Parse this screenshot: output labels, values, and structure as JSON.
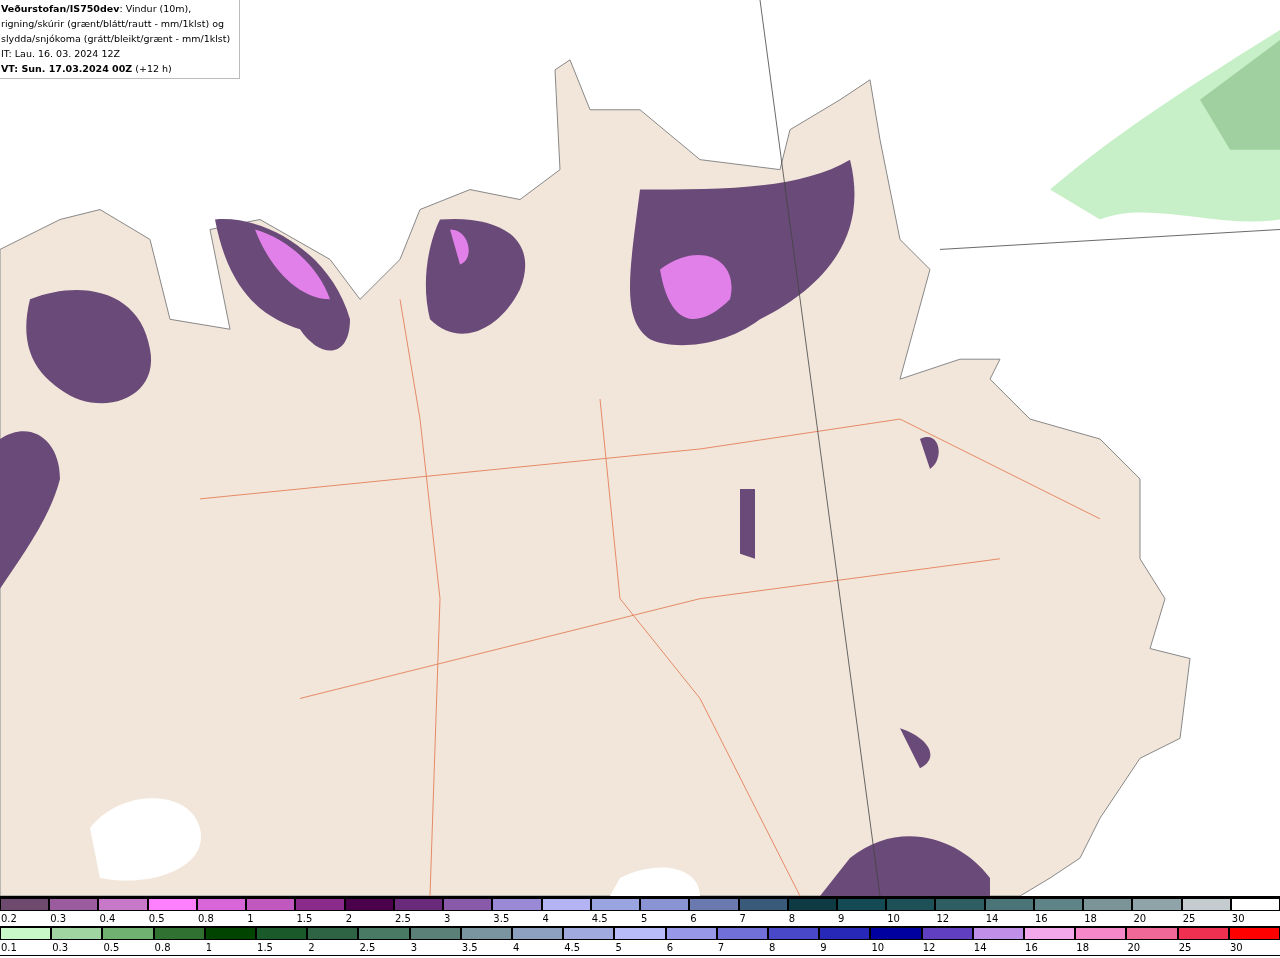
{
  "title_box": {
    "description": "**Veðurstofan/IS750dev**: Vindur (10m), rigning/skúrir (grænt/blátt/rautt - mm/1klst) og slydda/snjókoma (grátt/bleikt/grænt - mm/1klst)",
    "issue_time": "IT: Lau. 16. 03. 2024 12Z",
    "valid_time": "**VT: Sun. 17.03.2024 00Z** (+12 h)"
  },
  "legends": [
    {
      "steps": [
        {
          "label": "0.2",
          "color": "#6e4a6e"
        },
        {
          "label": "0.3",
          "color": "#9a5c9e"
        },
        {
          "label": "0.4",
          "color": "#c878c8"
        },
        {
          "label": "0.5",
          "color": "#ff80ff"
        },
        {
          "label": "0.8",
          "color": "#d966d9"
        },
        {
          "label": "1",
          "color": "#c058c0"
        },
        {
          "label": "1.5",
          "color": "#8a2a8a"
        },
        {
          "label": "2",
          "color": "#4a004a"
        },
        {
          "label": "2.5",
          "color": "#6a2a7a"
        },
        {
          "label": "3",
          "color": "#8a5aaa"
        },
        {
          "label": "3.5",
          "color": "#9a8ad6"
        },
        {
          "label": "4",
          "color": "#b4b4f4"
        },
        {
          "label": "4.5",
          "color": "#9aa4e0"
        },
        {
          "label": "5",
          "color": "#8a94d4"
        },
        {
          "label": "6",
          "color": "#6a7aae"
        },
        {
          "label": "7",
          "color": "#3a5a7a"
        },
        {
          "label": "8",
          "color": "#0e3a44"
        },
        {
          "label": "9",
          "color": "#144a54"
        },
        {
          "label": "10",
          "color": "#1e5058"
        },
        {
          "label": "12",
          "color": "#2e5e62"
        },
        {
          "label": "14",
          "color": "#4a7478"
        },
        {
          "label": "16",
          "color": "#5e8488"
        },
        {
          "label": "18",
          "color": "#7a9498"
        },
        {
          "label": "20",
          "color": "#8ea4a8"
        },
        {
          "label": "25",
          "color": "#c4ccd0"
        },
        {
          "label": "30",
          "color": "#ffffff"
        }
      ]
    },
    {
      "steps": [
        {
          "label": "0.1",
          "color": "#c8f8c8"
        },
        {
          "label": "0.3",
          "color": "#a0d4a0"
        },
        {
          "label": "0.5",
          "color": "#70b070"
        },
        {
          "label": "0.8",
          "color": "#307030"
        },
        {
          "label": "1",
          "color": "#004400"
        },
        {
          "label": "1.5",
          "color": "#1a5a2a"
        },
        {
          "label": "2",
          "color": "#2e6444"
        },
        {
          "label": "2.5",
          "color": "#487a64"
        },
        {
          "label": "3",
          "color": "#5a8078"
        },
        {
          "label": "3.5",
          "color": "#7a94a0"
        },
        {
          "label": "4",
          "color": "#8ea0c0"
        },
        {
          "label": "4.5",
          "color": "#a0aade"
        },
        {
          "label": "5",
          "color": "#b8bcf8"
        },
        {
          "label": "6",
          "color": "#9898e8"
        },
        {
          "label": "7",
          "color": "#7070d8"
        },
        {
          "label": "8",
          "color": "#4848c8"
        },
        {
          "label": "9",
          "color": "#2828b8"
        },
        {
          "label": "10",
          "color": "#0000a0"
        },
        {
          "label": "12",
          "color": "#6040c0"
        },
        {
          "label": "14",
          "color": "#c090e8"
        },
        {
          "label": "16",
          "color": "#f4a8ec"
        },
        {
          "label": "18",
          "color": "#f488c8"
        },
        {
          "label": "20",
          "color": "#f06898"
        },
        {
          "label": "25",
          "color": "#f03050"
        },
        {
          "label": "30",
          "color": "#ff0000"
        }
      ]
    }
  ]
}
